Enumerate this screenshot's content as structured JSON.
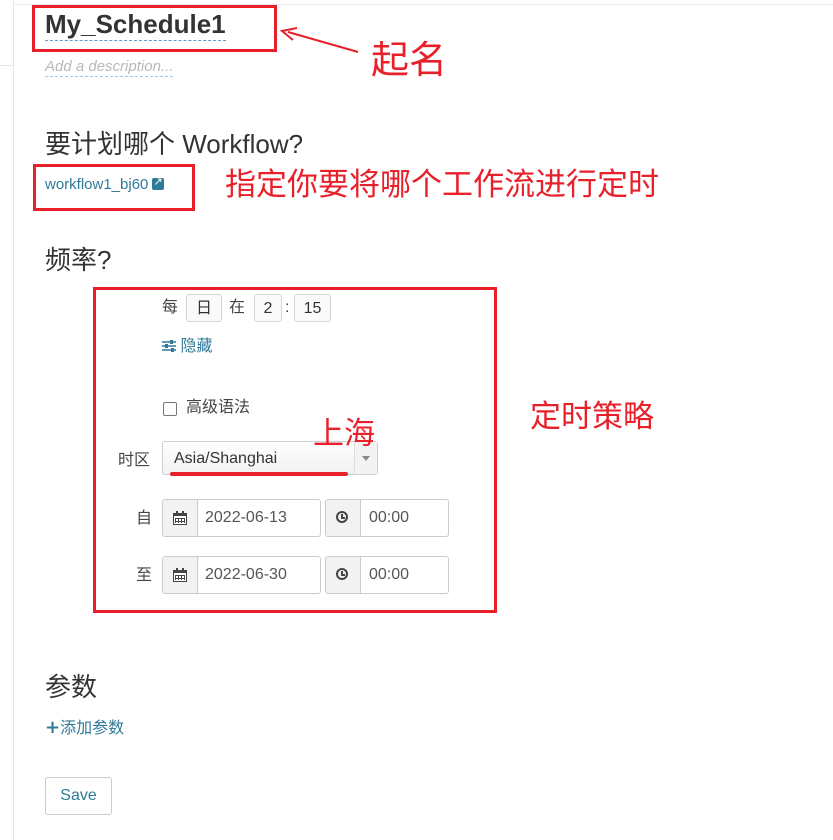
{
  "schedule": {
    "name": "My_Schedule1",
    "description_placeholder": "Add a description..."
  },
  "workflow_section": {
    "heading": "要计划哪个 Workflow?",
    "workflow_link": "workflow1_bj60"
  },
  "frequency_section": {
    "heading": "频率?",
    "cron": {
      "every_label": "每",
      "unit_value": "日",
      "at_label": "在",
      "hour_value": "2",
      "separator": ":",
      "minute_value": "15"
    },
    "hide_link": "隐藏",
    "advanced_syntax_label": "高级语法",
    "advanced_syntax_checked": false,
    "timezone_label": "时区",
    "timezone_value": "Asia/Shanghai",
    "from_label": "自",
    "from_date": "2022-06-13",
    "from_time": "00:00",
    "to_label": "至",
    "to_date": "2022-06-30",
    "to_time": "00:00"
  },
  "parameters_section": {
    "heading": "参数",
    "add_parameter_link": "添加参数"
  },
  "actions": {
    "save_label": "Save"
  },
  "annotations": {
    "name_note": "起名",
    "workflow_note": "指定你要将哪个工作流进行定时",
    "policy_note": "定时策略",
    "timezone_note": "上海",
    "color": "#e8202a"
  },
  "colors": {
    "link": "#2f7a99",
    "text": "#333333"
  },
  "icons": [
    "external-link-icon",
    "sliders-icon",
    "calendar-icon",
    "clock-icon",
    "plus-icon",
    "chevron-down-icon",
    "arrow-icon"
  ]
}
